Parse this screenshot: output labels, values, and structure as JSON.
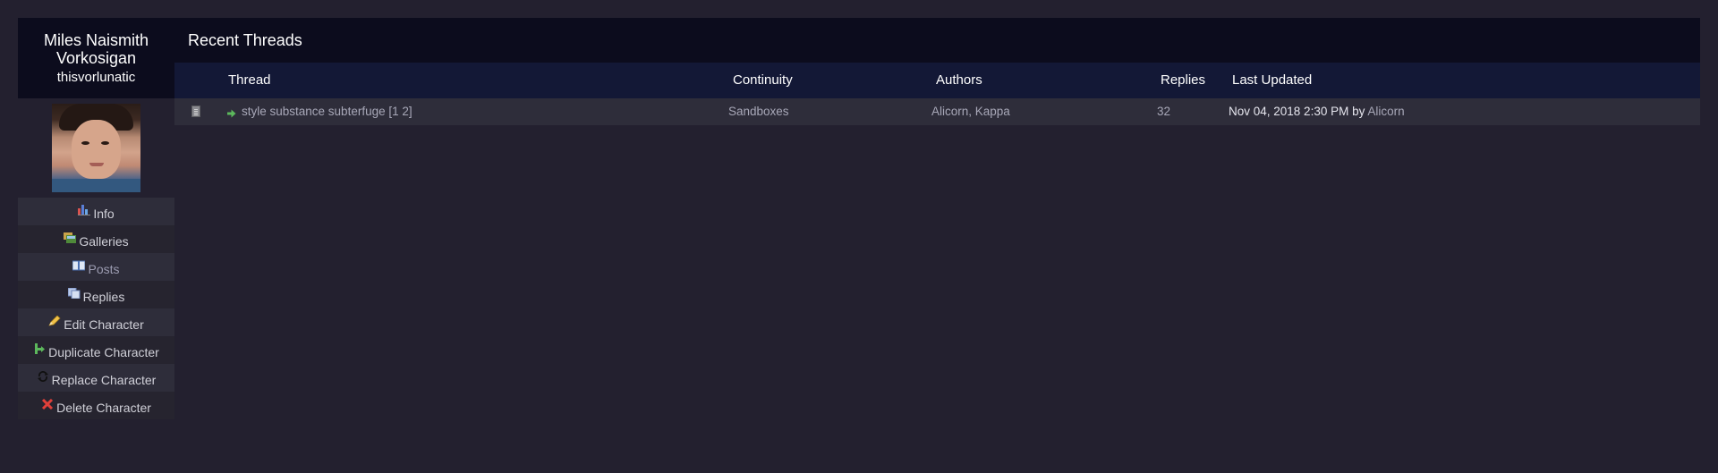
{
  "character": {
    "name": "Miles Naismith Vorkosigan",
    "screenname": "thisvorlunatic"
  },
  "menu": [
    {
      "label": "Info",
      "icon": "chart-icon"
    },
    {
      "label": "Galleries",
      "icon": "images-icon"
    },
    {
      "label": "Posts",
      "icon": "book-icon"
    },
    {
      "label": "Replies",
      "icon": "pages-icon"
    },
    {
      "label": "Edit Character",
      "icon": "pencil-icon"
    },
    {
      "label": "Duplicate Character",
      "icon": "branch-icon"
    },
    {
      "label": "Replace Character",
      "icon": "swap-icon"
    },
    {
      "label": "Delete Character",
      "icon": "x-icon"
    }
  ],
  "main": {
    "title": "Recent Threads",
    "headers": {
      "thread": "Thread",
      "continuity": "Continuity",
      "authors": "Authors",
      "replies": "Replies",
      "last_updated": "Last Updated"
    },
    "rows": [
      {
        "title": "style substance subterfuge",
        "pages": "[1 2]",
        "continuity": "Sandboxes",
        "authors": "Alicorn, Kappa",
        "replies": "32",
        "updated": "Nov 04, 2018 2:30 PM",
        "by_label": "by",
        "by_user": "Alicorn"
      }
    ]
  },
  "colors": {
    "page_bg": "#23202f",
    "header_bg": "#0c0c1d",
    "table_head_bg": "#131836",
    "row_bg": "#2e2d3a"
  }
}
